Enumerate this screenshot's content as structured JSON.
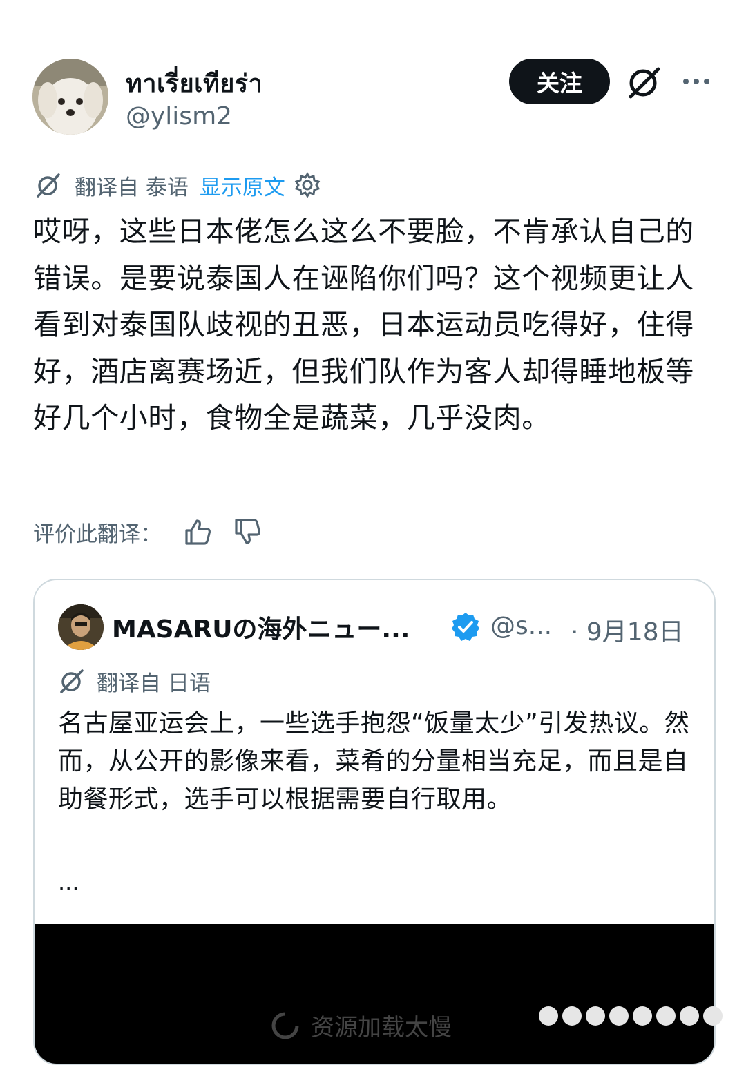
{
  "author": {
    "display_name": "ทาเรี่ยเทียร่า",
    "handle": "@ylism2",
    "avatar": "dog-avatar"
  },
  "actions": {
    "follow_label": "关注",
    "grok_icon": "grok-icon",
    "more_icon": "more-icon"
  },
  "translation": {
    "prefix": "翻译自 泰语",
    "show_original": "显示原文",
    "settings_icon": "gear-icon"
  },
  "tweet": {
    "text": "哎呀，这些日本佬怎么这么不要脸，不肯承认自己的错误。是要说泰国人在诬陷你们吗？这个视频更让人看到对泰国队歧视的丑恶，日本运动员吃得好，住得好，酒店离赛场近，但我们队作为客人却得睡地板等好几个小时，食物全是蔬菜，几乎没肉。"
  },
  "rating": {
    "label": "评价此翻译：",
    "thumbs_up_icon": "thumbs-up-icon",
    "thumbs_down_icon": "thumbs-down-icon"
  },
  "quote": {
    "name": "MASARUの海外ニュー...",
    "verified": true,
    "handle": "@s...",
    "date": "· 9月18日",
    "translation_prefix": "翻译自 日语",
    "text": "名古屋亚运会上，一些选手抱怨“饭量太少”引发热议。然而，从公开的影像来看，菜肴的分量相当充足，而且是自助餐形式，选手可以根据需要自行取用。",
    "ellipsis": "...",
    "media_status": "资源加载太慢"
  },
  "colors": {
    "text": "#0f1419",
    "secondary": "#536471",
    "link": "#1d9bf0",
    "verified": "#1d9bf0",
    "border": "#cfd9de"
  }
}
